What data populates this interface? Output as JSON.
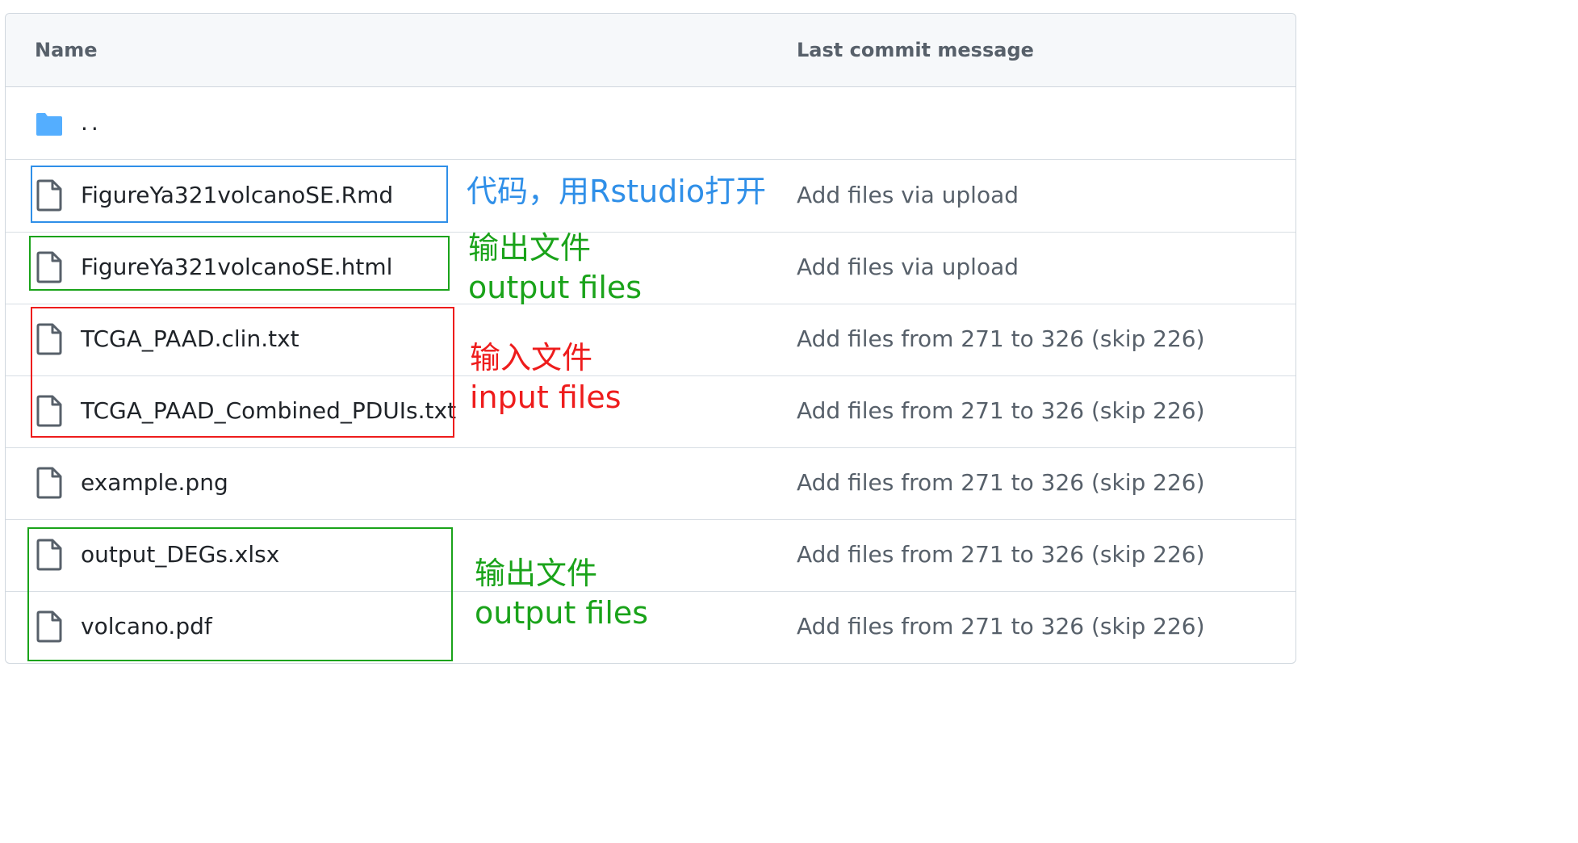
{
  "header": {
    "name_col": "Name",
    "commit_col": "Last commit message"
  },
  "parent_dir": "..",
  "files": [
    {
      "name": "FigureYa321volcanoSE.Rmd",
      "commit": "Add files via upload"
    },
    {
      "name": "FigureYa321volcanoSE.html",
      "commit": "Add files via upload"
    },
    {
      "name": "TCGA_PAAD.clin.txt",
      "commit": "Add files from 271 to 326 (skip 226)"
    },
    {
      "name": "TCGA_PAAD_Combined_PDUIs.txt",
      "commit": "Add files from 271 to 326 (skip 226)"
    },
    {
      "name": "example.png",
      "commit": "Add files from 271 to 326 (skip 226)"
    },
    {
      "name": "output_DEGs.xlsx",
      "commit": "Add files from 271 to 326 (skip 226)"
    },
    {
      "name": "volcano.pdf",
      "commit": "Add files from 271 to 326 (skip 226)"
    }
  ],
  "annotations": {
    "code": "代码，用Rstudio打开",
    "output1_cn": "输出文件",
    "output1_en": "output files",
    "input_cn": "输入文件",
    "input_en": "input files",
    "output2_cn": "输出文件",
    "output2_en": "output files"
  },
  "colors": {
    "folder": "#54aeff",
    "file_icon": "#57606a",
    "blue": "#2f8fe8",
    "green": "#1aa31a",
    "red": "#ee1c1c"
  },
  "icons": {
    "folder": "folder-icon",
    "file": "file-icon"
  }
}
